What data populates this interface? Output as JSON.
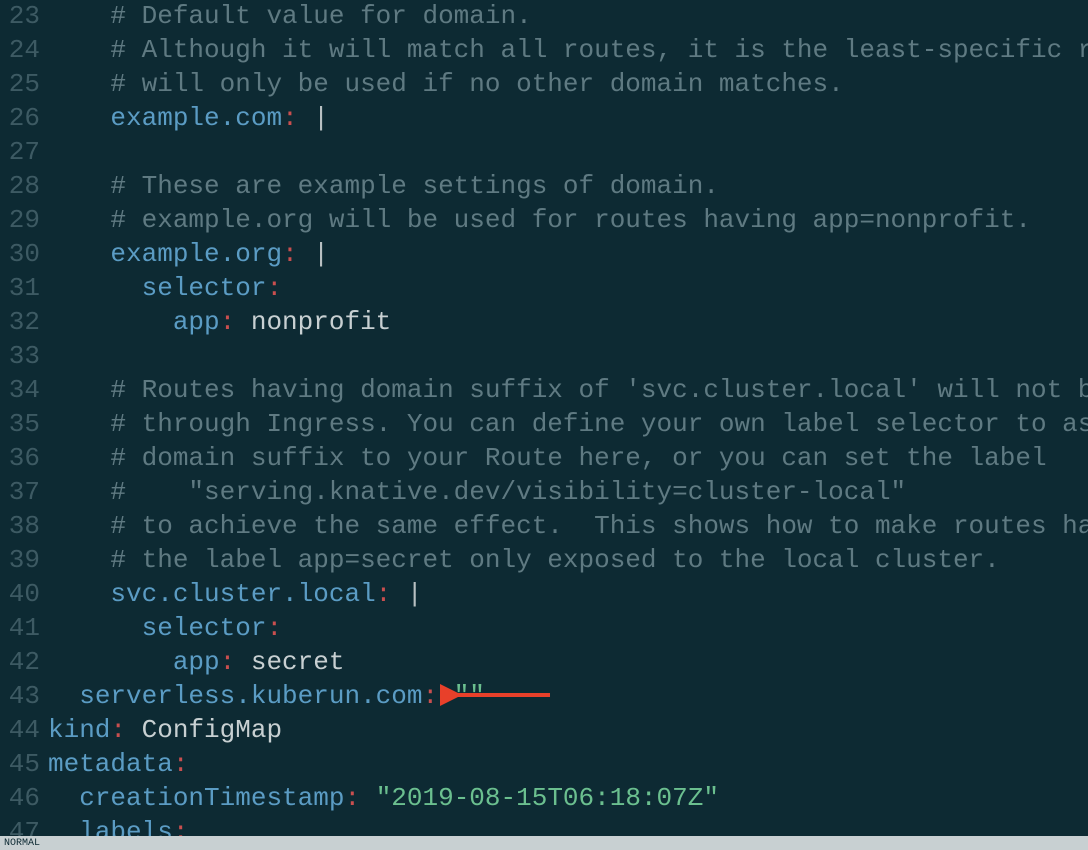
{
  "lines": [
    {
      "n": "23",
      "indent": "    ",
      "segments": [
        {
          "cls": "comment",
          "t": "# Default value for domain."
        }
      ]
    },
    {
      "n": "24",
      "indent": "    ",
      "segments": [
        {
          "cls": "comment",
          "t": "# Although it will match all routes, it is the least-specific rule so"
        }
      ]
    },
    {
      "n": "25",
      "indent": "    ",
      "segments": [
        {
          "cls": "comment",
          "t": "# will only be used if no other domain matches."
        }
      ]
    },
    {
      "n": "26",
      "indent": "    ",
      "segments": [
        {
          "cls": "key",
          "t": "example.com"
        },
        {
          "cls": "colon",
          "t": ":"
        },
        {
          "cls": "pipe",
          "t": " |"
        }
      ]
    },
    {
      "n": "27",
      "indent": "",
      "segments": []
    },
    {
      "n": "28",
      "indent": "    ",
      "segments": [
        {
          "cls": "comment",
          "t": "# These are example settings of domain."
        }
      ]
    },
    {
      "n": "29",
      "indent": "    ",
      "segments": [
        {
          "cls": "comment",
          "t": "# example.org will be used for routes having app=nonprofit."
        }
      ]
    },
    {
      "n": "30",
      "indent": "    ",
      "segments": [
        {
          "cls": "key",
          "t": "example.org"
        },
        {
          "cls": "colon",
          "t": ":"
        },
        {
          "cls": "pipe",
          "t": " |"
        }
      ]
    },
    {
      "n": "31",
      "indent": "      ",
      "segments": [
        {
          "cls": "key",
          "t": "selector"
        },
        {
          "cls": "colon",
          "t": ":"
        }
      ]
    },
    {
      "n": "32",
      "indent": "        ",
      "segments": [
        {
          "cls": "key",
          "t": "app"
        },
        {
          "cls": "colon",
          "t": ":"
        },
        {
          "cls": "val",
          "t": " nonprofit"
        }
      ]
    },
    {
      "n": "33",
      "indent": "",
      "segments": []
    },
    {
      "n": "34",
      "indent": "    ",
      "segments": [
        {
          "cls": "comment",
          "t": "# Routes having domain suffix of 'svc.cluster.local' will not be expos"
        }
      ]
    },
    {
      "n": "35",
      "indent": "    ",
      "segments": [
        {
          "cls": "comment",
          "t": "# through Ingress. You can define your own label selector to assign th"
        }
      ]
    },
    {
      "n": "36",
      "indent": "    ",
      "segments": [
        {
          "cls": "comment",
          "t": "# domain suffix to your Route here, or you can set the label"
        }
      ]
    },
    {
      "n": "37",
      "indent": "    ",
      "segments": [
        {
          "cls": "comment",
          "t": "#    \"serving.knative.dev/visibility=cluster-local\""
        }
      ]
    },
    {
      "n": "38",
      "indent": "    ",
      "segments": [
        {
          "cls": "comment",
          "t": "# to achieve the same effect.  This shows how to make routes having"
        }
      ]
    },
    {
      "n": "39",
      "indent": "    ",
      "segments": [
        {
          "cls": "comment",
          "t": "# the label app=secret only exposed to the local cluster."
        }
      ]
    },
    {
      "n": "40",
      "indent": "    ",
      "segments": [
        {
          "cls": "key",
          "t": "svc.cluster.local"
        },
        {
          "cls": "colon",
          "t": ":"
        },
        {
          "cls": "pipe",
          "t": " |"
        }
      ]
    },
    {
      "n": "41",
      "indent": "      ",
      "segments": [
        {
          "cls": "key",
          "t": "selector"
        },
        {
          "cls": "colon",
          "t": ":"
        }
      ]
    },
    {
      "n": "42",
      "indent": "        ",
      "segments": [
        {
          "cls": "key",
          "t": "app"
        },
        {
          "cls": "colon",
          "t": ":"
        },
        {
          "cls": "val",
          "t": " secret"
        }
      ]
    },
    {
      "n": "43",
      "indent": "  ",
      "segments": [
        {
          "cls": "key",
          "t": "serverless.kuberun.com"
        },
        {
          "cls": "colon",
          "t": ":"
        },
        {
          "cls": "val",
          "t": " "
        },
        {
          "cls": "str",
          "t": "\"\""
        }
      ]
    },
    {
      "n": "44",
      "indent": "",
      "segments": [
        {
          "cls": "key",
          "t": "kind"
        },
        {
          "cls": "colon",
          "t": ":"
        },
        {
          "cls": "val",
          "t": " ConfigMap"
        }
      ]
    },
    {
      "n": "45",
      "indent": "",
      "segments": [
        {
          "cls": "key",
          "t": "metadata"
        },
        {
          "cls": "colon",
          "t": ":"
        }
      ]
    },
    {
      "n": "46",
      "indent": "  ",
      "segments": [
        {
          "cls": "key",
          "t": "creationTimestamp"
        },
        {
          "cls": "colon",
          "t": ":"
        },
        {
          "cls": "val",
          "t": " "
        },
        {
          "cls": "str",
          "t": "\"2019-08-15T06:18:07Z\""
        }
      ]
    },
    {
      "n": "47",
      "indent": "  ",
      "segments": [
        {
          "cls": "key",
          "t": "labels"
        },
        {
          "cls": "colon",
          "t": ":"
        }
      ]
    }
  ],
  "status": "NORMAL",
  "arrow_color": "#e8402a"
}
